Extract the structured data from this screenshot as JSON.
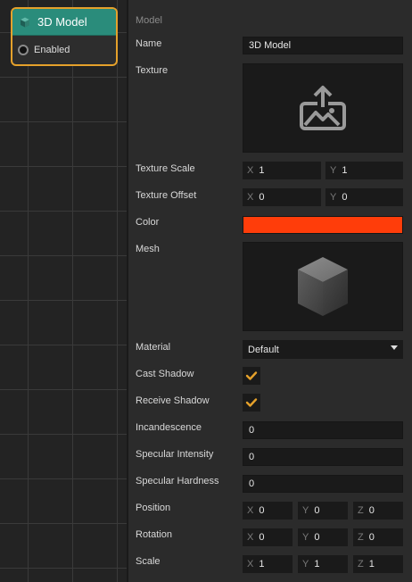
{
  "node": {
    "title": "3D Model",
    "port_label": "Enabled",
    "accent": "#2a8c7b",
    "border": "#e5a12b"
  },
  "inspector": {
    "section_title": "Model",
    "name": {
      "label": "Name",
      "value": "3D Model"
    },
    "texture": {
      "label": "Texture",
      "icon": "upload-image-icon"
    },
    "texture_scale": {
      "label": "Texture Scale",
      "x_axis": "X",
      "x": "1",
      "y_axis": "Y",
      "y": "1"
    },
    "texture_offset": {
      "label": "Texture Offset",
      "x_axis": "X",
      "x": "0",
      "y_axis": "Y",
      "y": "0"
    },
    "color": {
      "label": "Color",
      "value": "#ff3d0a"
    },
    "mesh": {
      "label": "Mesh",
      "icon": "cube-mesh-icon"
    },
    "material": {
      "label": "Material",
      "value": "Default"
    },
    "cast_shadow": {
      "label": "Cast Shadow",
      "checked": true
    },
    "receive_shadow": {
      "label": "Receive Shadow",
      "checked": true
    },
    "incandescence": {
      "label": "Incandescence",
      "value": "0"
    },
    "specular_intensity": {
      "label": "Specular Intensity",
      "value": "0"
    },
    "specular_hardness": {
      "label": "Specular Hardness",
      "value": "0"
    },
    "position": {
      "label": "Position",
      "x_axis": "X",
      "x": "0",
      "y_axis": "Y",
      "y": "0",
      "z_axis": "Z",
      "z": "0"
    },
    "rotation": {
      "label": "Rotation",
      "x_axis": "X",
      "x": "0",
      "y_axis": "Y",
      "y": "0",
      "z_axis": "Z",
      "z": "0"
    },
    "scale": {
      "label": "Scale",
      "x_axis": "X",
      "x": "1",
      "y_axis": "Y",
      "y": "1",
      "z_axis": "Z",
      "z": "1"
    },
    "check_color": "#e5a12b"
  }
}
